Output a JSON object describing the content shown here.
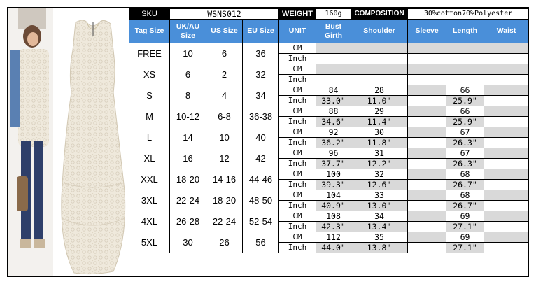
{
  "header": {
    "sku_label": "SKU",
    "sku_value": "WSNS012",
    "weight_label": "WEIGHT",
    "weight_value": "160g",
    "composition_label": "COMPOSITION",
    "composition_value": "30%cotton70%Polyester"
  },
  "columns": {
    "tag_size": "Tag Size",
    "uk_au_size": "UK/AU Size",
    "us_size": "US Size",
    "eu_size": "EU Size",
    "unit": "UNIT",
    "bust_girth": "Bust Girth",
    "shoulder": "Shoulder",
    "sleeve": "Sleeve",
    "length": "Length",
    "waist": "Waist"
  },
  "units": {
    "cm": "CM",
    "inch": "Inch"
  },
  "rows": [
    {
      "tag": "FREE",
      "uk": "10",
      "us": "6",
      "eu": "36",
      "bust_cm": "",
      "bust_in": "",
      "shoulder_cm": "",
      "shoulder_in": "",
      "length_cm": "",
      "length_in": ""
    },
    {
      "tag": "XS",
      "uk": "6",
      "us": "2",
      "eu": "32",
      "bust_cm": "",
      "bust_in": "",
      "shoulder_cm": "",
      "shoulder_in": "",
      "length_cm": "",
      "length_in": ""
    },
    {
      "tag": "S",
      "uk": "8",
      "us": "4",
      "eu": "34",
      "bust_cm": "84",
      "bust_in": "33.0\"",
      "shoulder_cm": "28",
      "shoulder_in": "11.0\"",
      "length_cm": "66",
      "length_in": "25.9\""
    },
    {
      "tag": "M",
      "uk": "10-12",
      "us": "6-8",
      "eu": "36-38",
      "bust_cm": "88",
      "bust_in": "34.6\"",
      "shoulder_cm": "29",
      "shoulder_in": "11.4\"",
      "length_cm": "66",
      "length_in": "25.9\""
    },
    {
      "tag": "L",
      "uk": "14",
      "us": "10",
      "eu": "40",
      "bust_cm": "92",
      "bust_in": "36.2\"",
      "shoulder_cm": "30",
      "shoulder_in": "11.8\"",
      "length_cm": "67",
      "length_in": "26.3\""
    },
    {
      "tag": "XL",
      "uk": "16",
      "us": "12",
      "eu": "42",
      "bust_cm": "96",
      "bust_in": "37.7\"",
      "shoulder_cm": "31",
      "shoulder_in": "12.2\"",
      "length_cm": "67",
      "length_in": "26.3\""
    },
    {
      "tag": "XXL",
      "uk": "18-20",
      "us": "14-16",
      "eu": "44-46",
      "bust_cm": "100",
      "bust_in": "39.3\"",
      "shoulder_cm": "32",
      "shoulder_in": "12.6\"",
      "length_cm": "68",
      "length_in": "26.7\""
    },
    {
      "tag": "3XL",
      "uk": "22-24",
      "us": "18-20",
      "eu": "48-50",
      "bust_cm": "104",
      "bust_in": "40.9\"",
      "shoulder_cm": "33",
      "shoulder_in": "13.0\"",
      "length_cm": "68",
      "length_in": "26.7\""
    },
    {
      "tag": "4XL",
      "uk": "26-28",
      "us": "22-24",
      "eu": "52-54",
      "bust_cm": "108",
      "bust_in": "42.3\"",
      "shoulder_cm": "34",
      "shoulder_in": "13.4\"",
      "length_cm": "69",
      "length_in": "27.1\""
    },
    {
      "tag": "5XL",
      "uk": "30",
      "us": "26",
      "eu": "56",
      "bust_cm": "112",
      "bust_in": "44.0\"",
      "shoulder_cm": "35",
      "shoulder_in": "13.8\"",
      "length_cm": "69",
      "length_in": "27.1\""
    }
  ],
  "colors": {
    "header_blue": "#4a8fd9",
    "gray_cell": "#d9d9d9",
    "label_black": "#000000"
  }
}
